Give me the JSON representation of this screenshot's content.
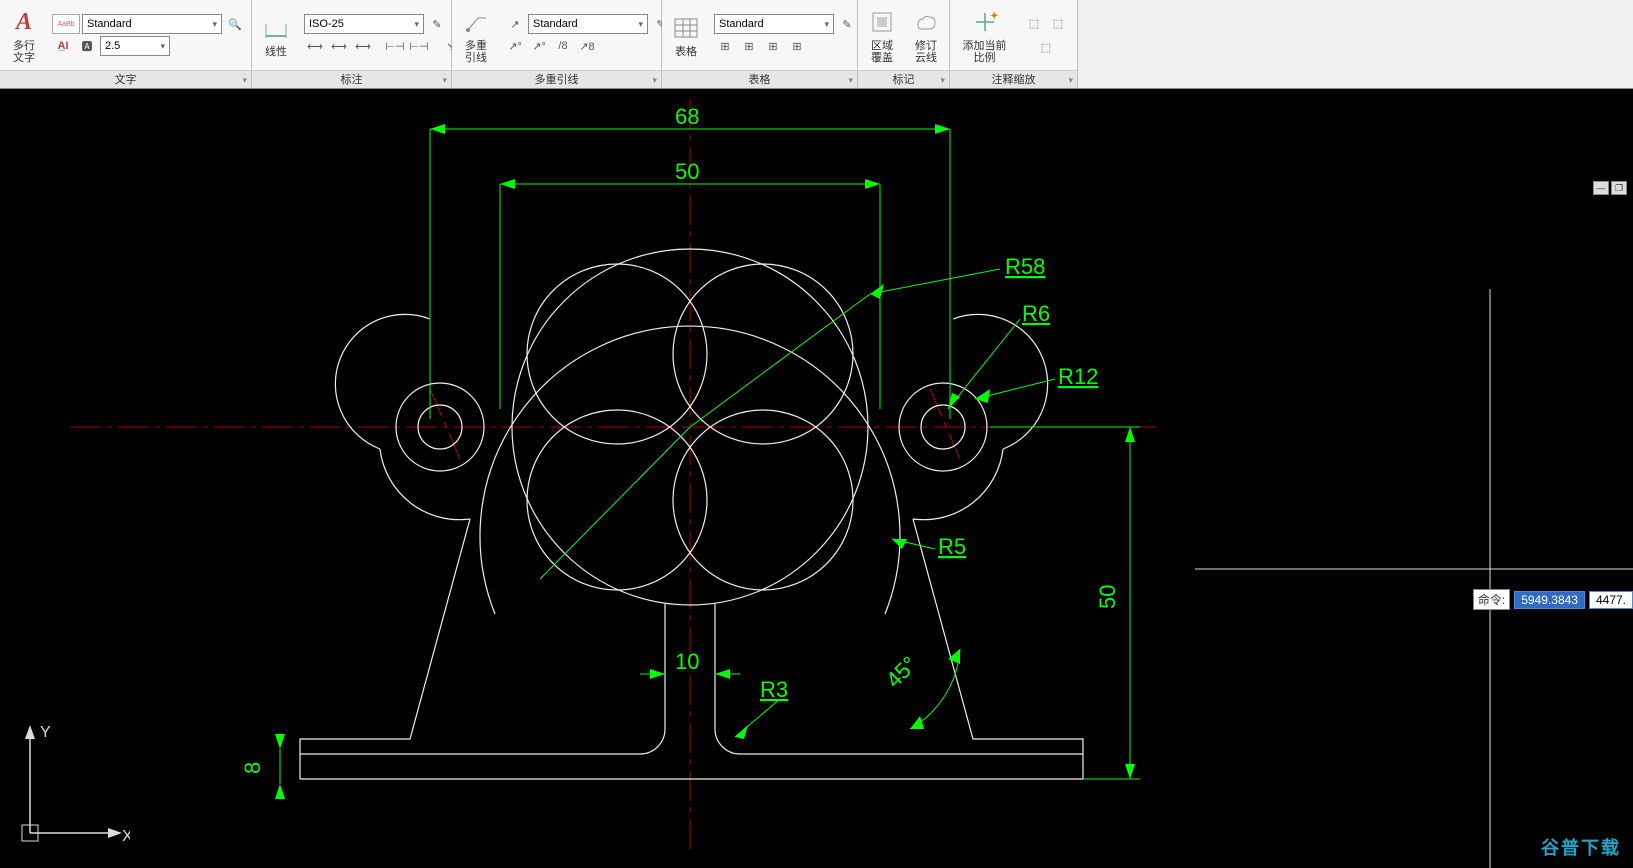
{
  "ribbon": {
    "text": {
      "title": "文字",
      "mtext_label": "多行\n文字",
      "style_select": "Standard",
      "height_select": "2.5"
    },
    "dim": {
      "title": "标注",
      "linear_label": "线性",
      "style_select": "ISO-25"
    },
    "mleader": {
      "title": "多重引线",
      "mleader_label": "多重引线",
      "style_select": "Standard"
    },
    "table": {
      "title": "表格",
      "table_label": "表格",
      "style_select": "Standard"
    },
    "markup": {
      "title": "标记",
      "wipeout_label": "区域覆盖",
      "revcloud_label": "修订\n云线"
    },
    "annoscale": {
      "title": "注释缩放",
      "add_label": "添加当前比例"
    }
  },
  "drawing": {
    "dims": {
      "d68": "68",
      "d50": "50",
      "d50v": "50",
      "d10": "10",
      "d8": "8",
      "r58": "R58",
      "r6": "R6",
      "r12": "R12",
      "r5": "R5",
      "r3": "R3",
      "a45": "45°"
    }
  },
  "ucs": {
    "x": "X",
    "y": "Y"
  },
  "cmd": {
    "label": "命令:",
    "val1": "5949.3843",
    "val2": "4477."
  },
  "watermark": "谷普下载"
}
